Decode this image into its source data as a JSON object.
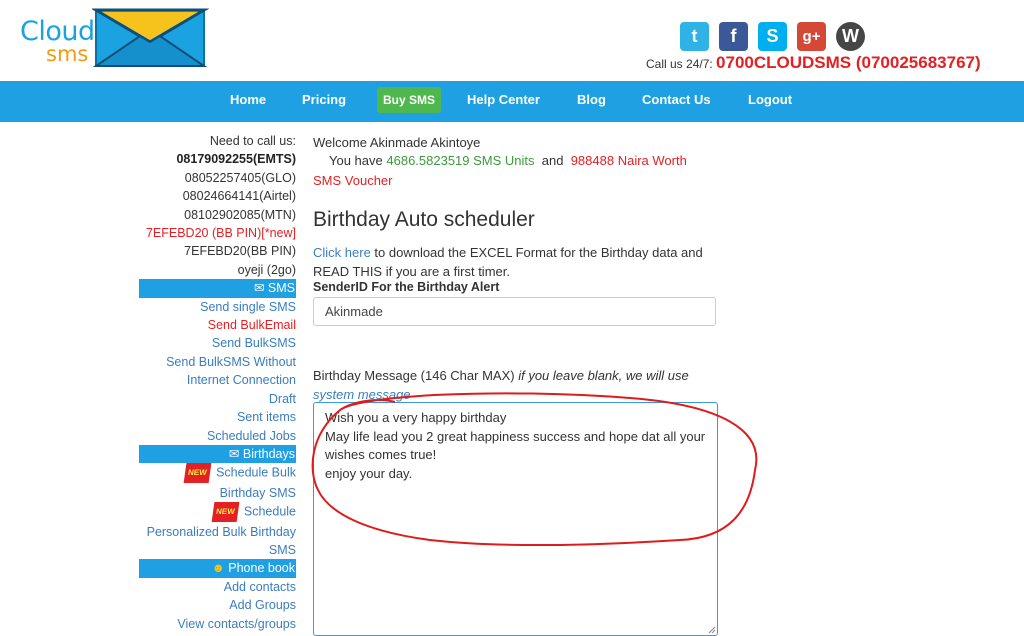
{
  "logo": {
    "line1": "Cloud",
    "line2": "sms"
  },
  "header": {
    "social": [
      "twitter-icon",
      "facebook-icon",
      "skype-icon",
      "google-plus-icon",
      "wordpress-icon"
    ],
    "callus_prefix": "Call us 24/7:",
    "callus_number": "0700CLOUDSMS (070025683767)"
  },
  "nav": {
    "home": "Home",
    "pricing": "Pricing",
    "buy": "Buy SMS",
    "help": "Help Center",
    "blog": "Blog",
    "contact": "Contact Us",
    "logout": "Logout"
  },
  "sidebar": {
    "need_call": "Need to call us:",
    "phones": {
      "emts": "08179092255(EMTS)",
      "glo": "08052257405(GLO)",
      "airtel": "08024664141(Airtel)",
      "mtn": "08102902085(MTN)",
      "bbpin_new": "7EFEBD20 (BB PIN)[*new]",
      "bbpin": "7EFEBD20(BB PIN)",
      "twogo": "oyeji (2go)"
    },
    "sms_section": "SMS",
    "send_single": "Send single SMS",
    "send_bulkemail": "Send BulkEmail",
    "send_bulksms": "Send BulkSMS",
    "send_without_1": "Send BulkSMS Without",
    "send_without_2": "Internet Connection",
    "draft": "Draft",
    "sent": "Sent items",
    "scheduled": "Scheduled Jobs",
    "birthdays_section": "Birthdays",
    "new_badge": "NEW",
    "schedule_bulk_1": "Schedule Bulk",
    "schedule_bulk_2": "Birthday SMS",
    "schedule": "Schedule",
    "personalized_1": "Personalized Bulk Birthday",
    "personalized_2": "SMS",
    "phonebook_section": "Phone book",
    "add_contacts": "Add contacts",
    "add_groups": "Add Groups",
    "view_contacts": "View contacts/groups"
  },
  "main": {
    "welcome": "Welcome Akinmade Akintoye",
    "units_prefix": "You have",
    "units_value": "4686.5823519 SMS Units",
    "units_and": "and",
    "naira_value": "988488 Naira Worth",
    "voucher": "SMS Voucher",
    "title": "Birthday Auto scheduler",
    "click_here": "Click here",
    "info_text": " to download the EXCEL Format for the Birthday data and READ THIS if you are a first timer.",
    "sender_label": "SenderID For the Birthday Alert",
    "sender_value": "Akinmade",
    "msg_label": "Birthday Message (146 Char MAX) ",
    "msg_hint": "if you leave blank, we will use",
    "msg_link": "system message",
    "message": "Wish you a very happy birthday\nMay life lead you 2 great happiness success and hope dat all your wishes comes true!\nenjoy your day."
  },
  "colors": {
    "accent": "#1fa0e2",
    "buy": "#4eb74e",
    "alert": "#e32124",
    "annotation": "#e01b1b"
  }
}
